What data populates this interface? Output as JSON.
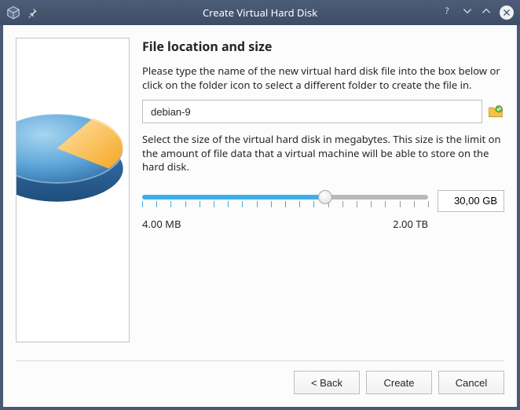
{
  "window": {
    "title": "Create Virtual Hard Disk"
  },
  "page": {
    "heading": "File location and size",
    "desc1": "Please type the name of the new virtual hard disk file into the box below or click on the folder icon to select a different folder to create the file in.",
    "desc2": "Select the size of the virtual hard disk in megabytes. This size is the limit on the amount of file data that a virtual machine will be able to store on the hard disk."
  },
  "file": {
    "value": "debian-9"
  },
  "size": {
    "value": "30,00 GB",
    "min_label": "4.00 MB",
    "max_label": "2.00 TB",
    "slider_percent": 64
  },
  "buttons": {
    "back": "< Back",
    "create": "Create",
    "cancel": "Cancel"
  }
}
